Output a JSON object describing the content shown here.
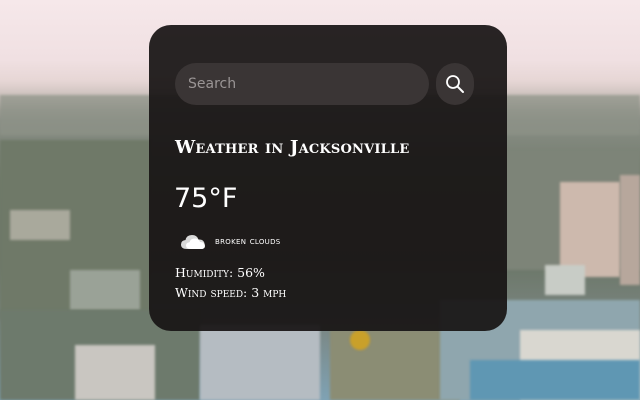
{
  "search": {
    "placeholder": "Search",
    "value": ""
  },
  "weather": {
    "title": "Weather in Jacksonville",
    "temperature": "75°F",
    "condition": "broken clouds",
    "humidity": "Humidity: 56%",
    "wind": "Wind speed: 3 mph"
  },
  "icons": {
    "search": "search-icon",
    "condition": "cloud-icon"
  },
  "colors": {
    "card": "#181414",
    "input": "#3a3535",
    "text": "#ffffff"
  }
}
